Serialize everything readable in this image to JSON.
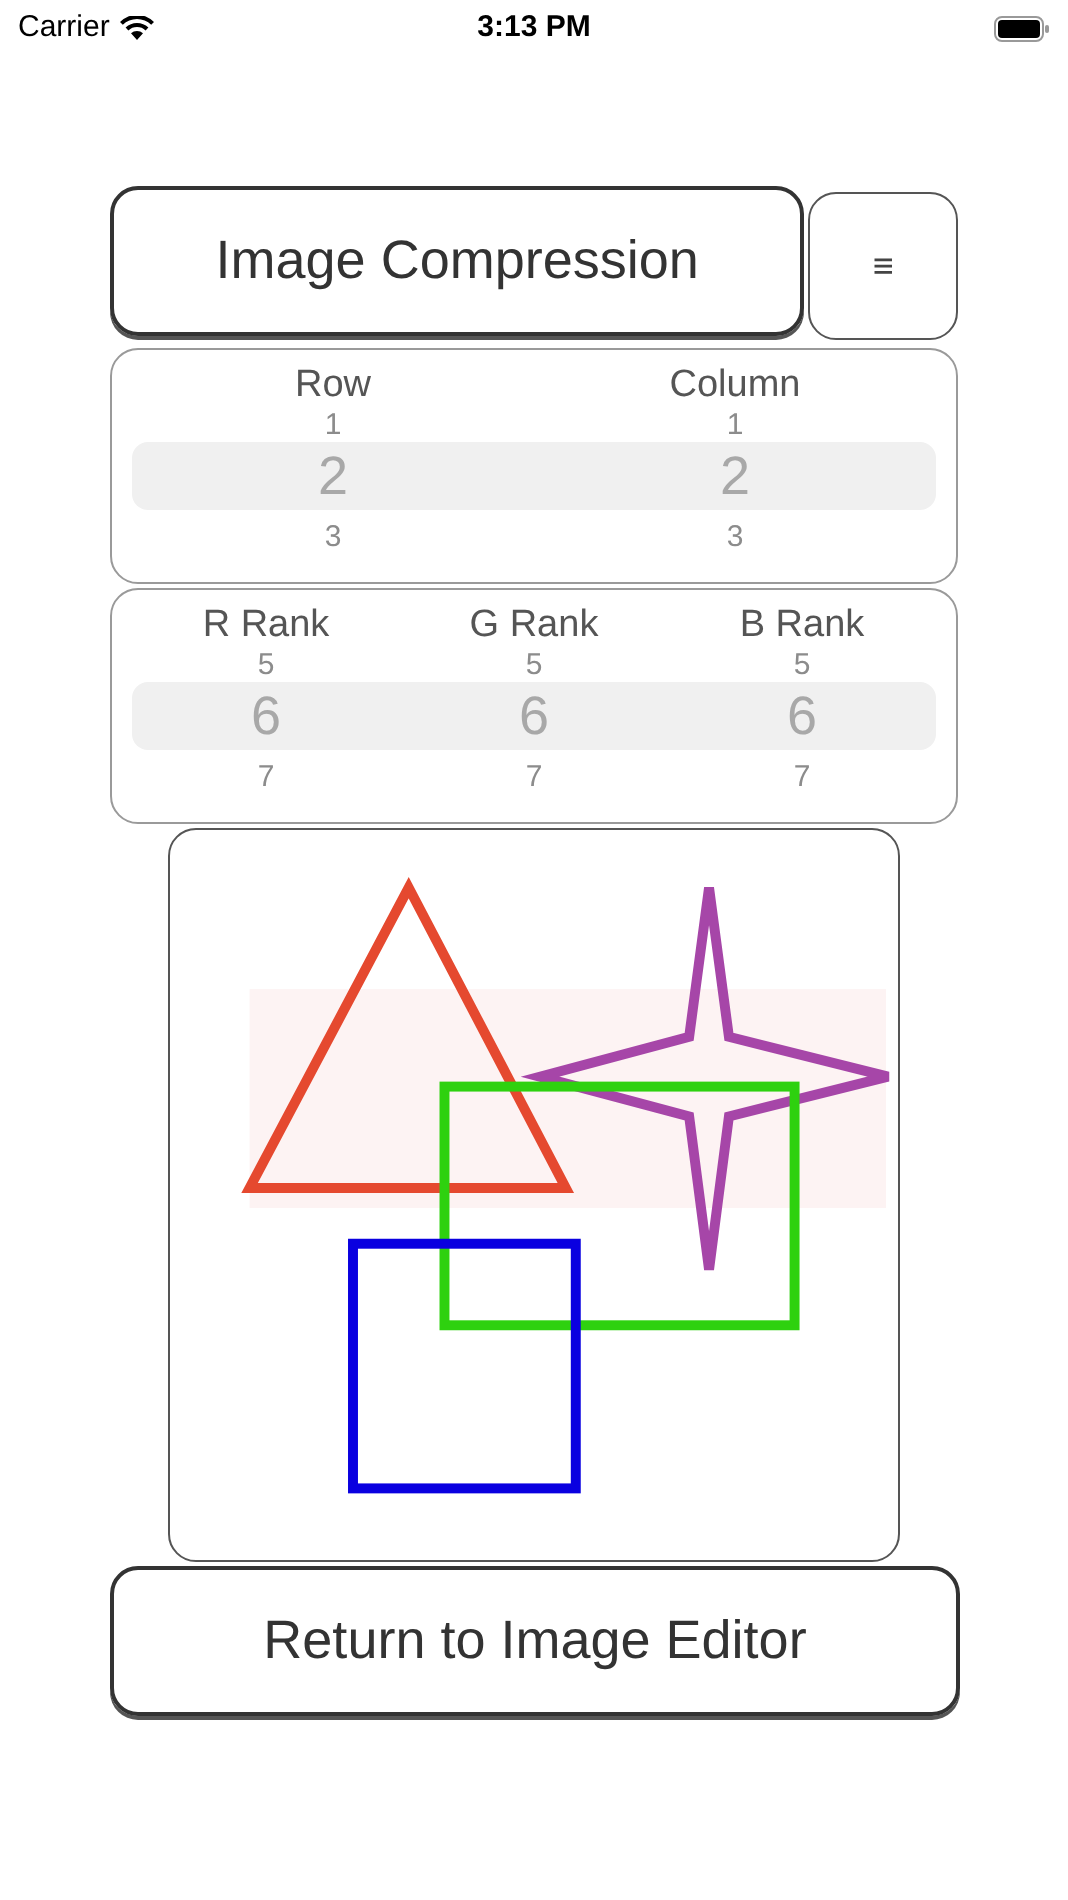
{
  "status_bar": {
    "carrier": "Carrier",
    "time": "3:13 PM"
  },
  "title_button": "Image Compression",
  "menu_button": "≡",
  "pickers": [
    {
      "columns": [
        {
          "label": "Row",
          "options": [
            {
              "text": "1",
              "selected": false
            },
            {
              "text": "2",
              "selected": true
            },
            {
              "text": "3",
              "selected": false
            }
          ]
        },
        {
          "label": "Column",
          "options": [
            {
              "text": "1",
              "selected": false
            },
            {
              "text": "2",
              "selected": true
            },
            {
              "text": "3",
              "selected": false
            }
          ]
        }
      ]
    },
    {
      "columns": [
        {
          "label": "R Rank",
          "options": [
            {
              "text": "5",
              "selected": false
            },
            {
              "text": "6",
              "selected": true
            },
            {
              "text": "7",
              "selected": false
            }
          ]
        },
        {
          "label": "G Rank",
          "options": [
            {
              "text": "5",
              "selected": false
            },
            {
              "text": "6",
              "selected": true
            },
            {
              "text": "7",
              "selected": false
            }
          ]
        },
        {
          "label": "B Rank",
          "options": [
            {
              "text": "5",
              "selected": false
            },
            {
              "text": "6",
              "selected": true
            },
            {
              "text": "7",
              "selected": false
            }
          ]
        }
      ]
    }
  ],
  "return_button": "Return to Image Editor"
}
